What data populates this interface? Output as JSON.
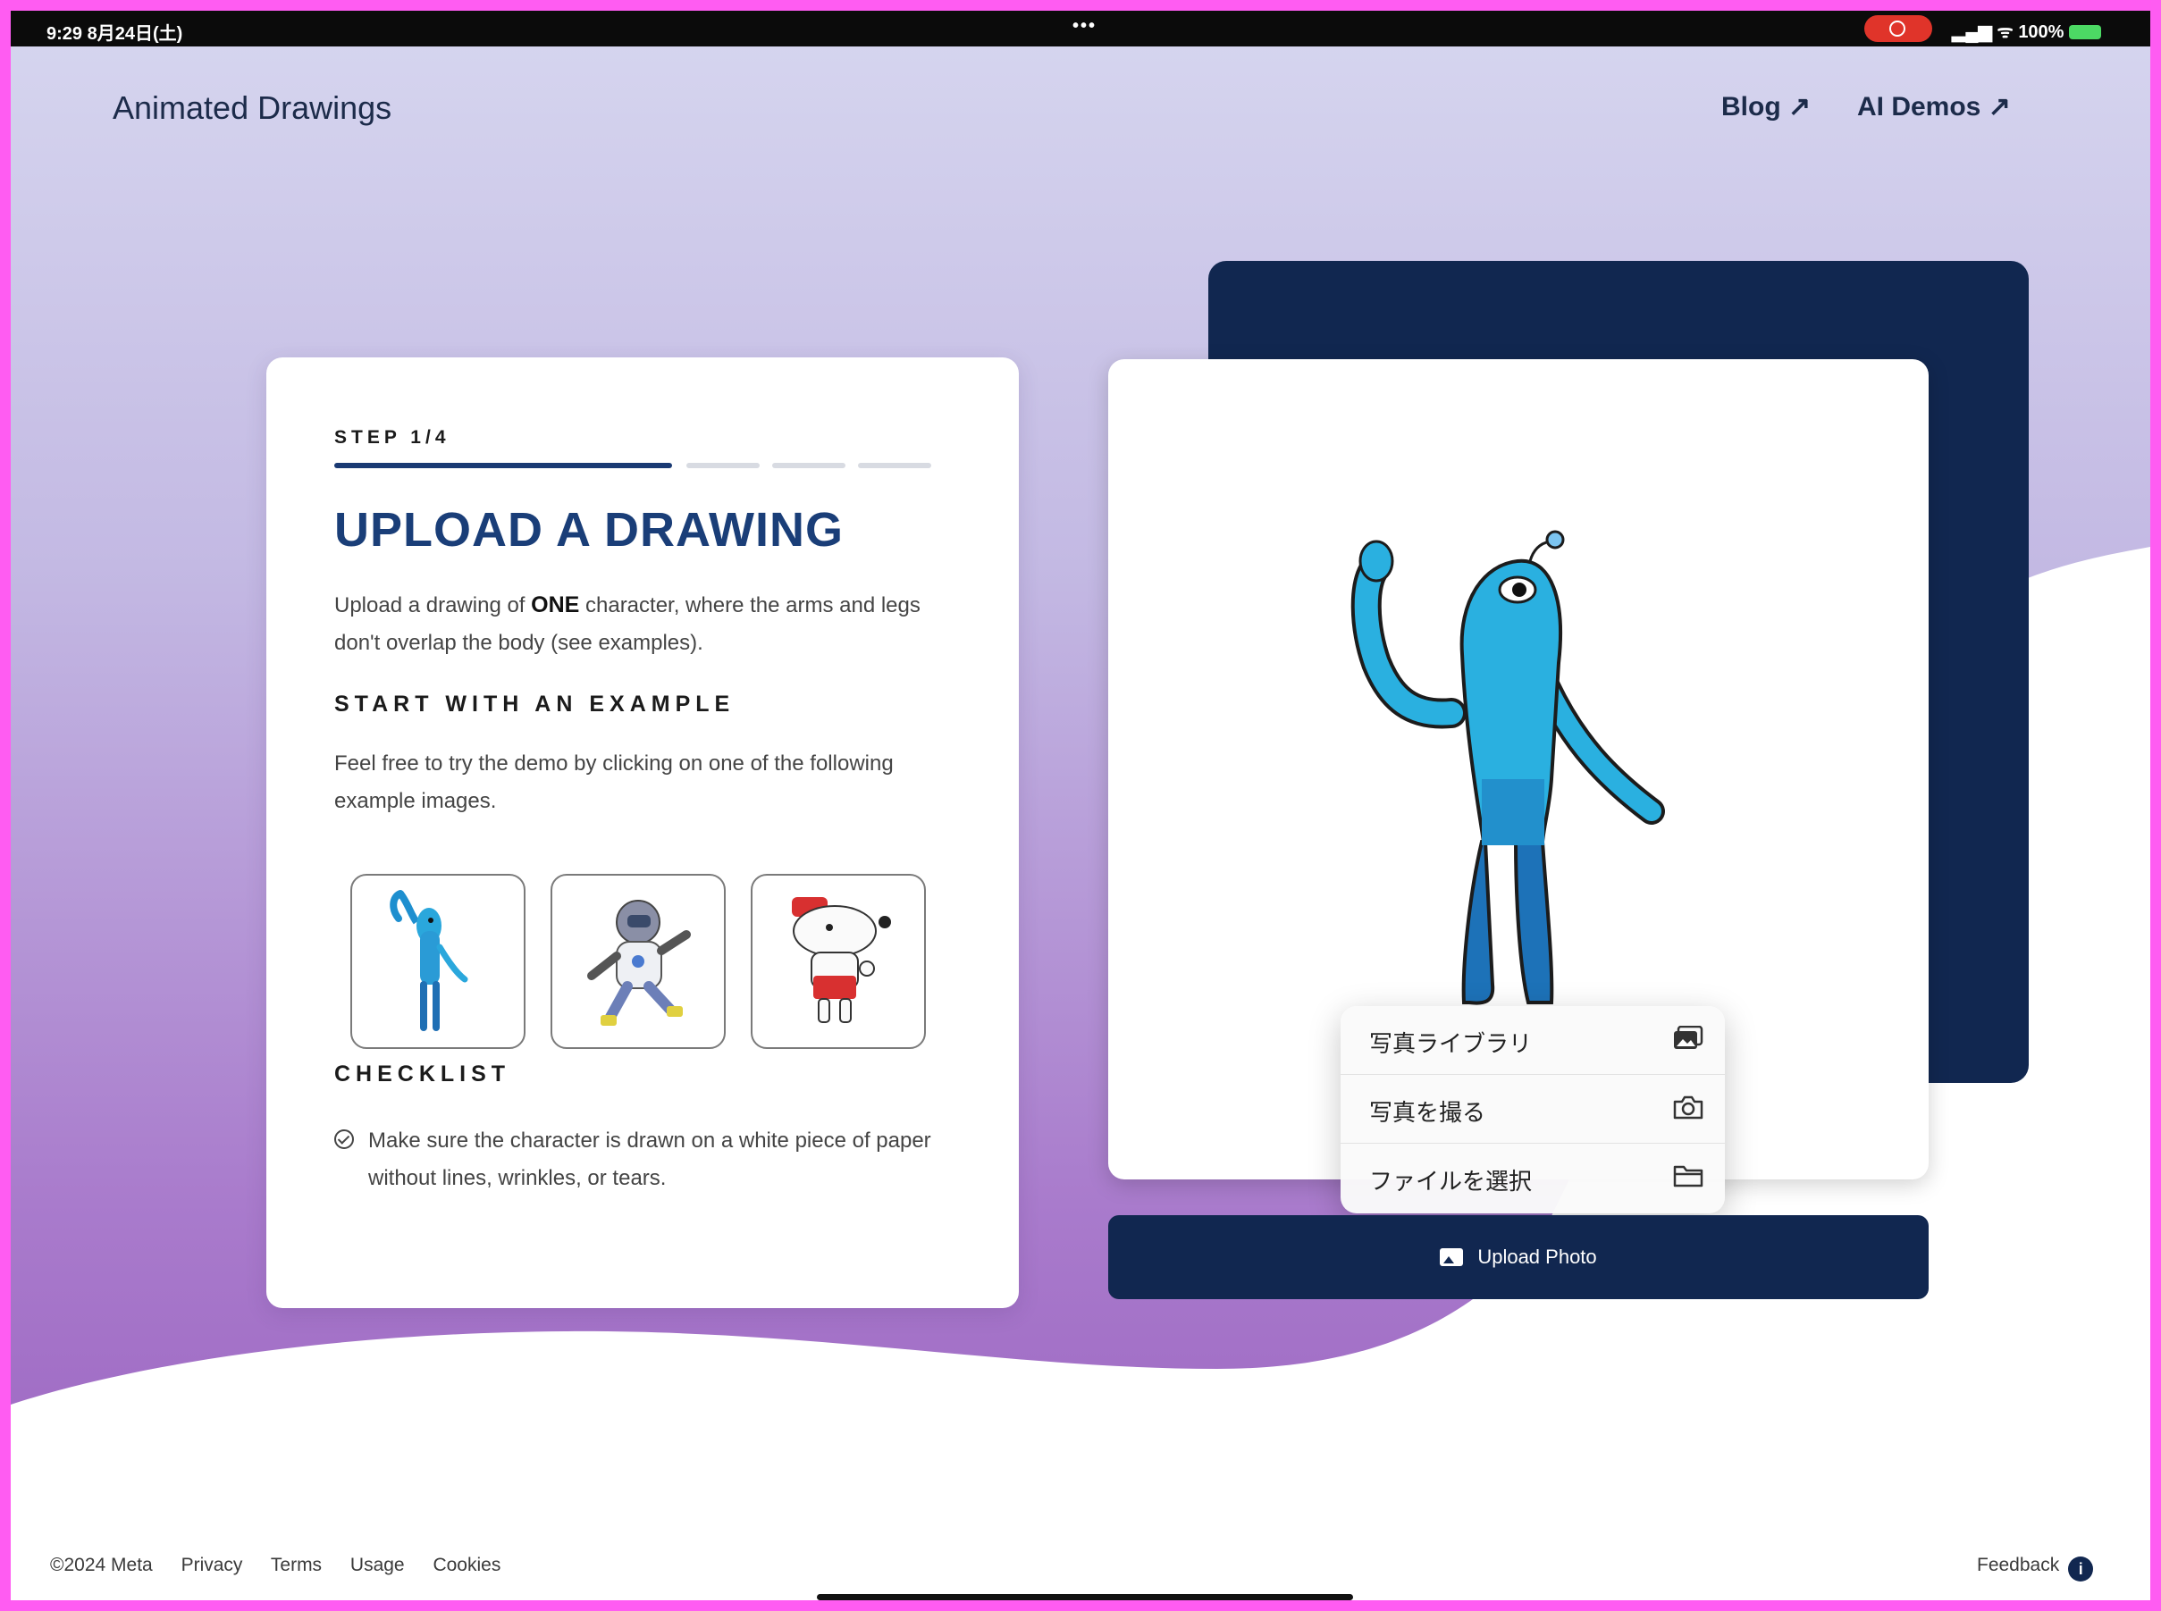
{
  "status_bar": {
    "time_date": "9:29  8月24日(土)",
    "dots": "•••",
    "signal_battery": "100%"
  },
  "header": {
    "title": "Animated Drawings",
    "links": [
      {
        "label": "Blog ↗"
      },
      {
        "label": "AI Demos ↗"
      }
    ]
  },
  "step_card": {
    "step_label": "STEP 1/4",
    "progress": {
      "current": 1,
      "total": 4
    },
    "title": "UPLOAD A DRAWING",
    "desc_before": "Upload a drawing of ",
    "desc_bold": "ONE",
    "desc_after": " character, where the arms and legs don't overlap the body (see examples).",
    "example_heading": "START WITH AN EXAMPLE",
    "example_desc": "Feel free to try the demo by clicking on one of the following example images.",
    "checklist_heading": "CHECKLIST",
    "checklist_items": [
      "Make sure the character is drawn on a white piece of paper without lines, wrinkles, or tears."
    ]
  },
  "picker_menu": {
    "items": [
      {
        "label": "写真ライブラリ",
        "icon": "photo-library-icon"
      },
      {
        "label": "写真を撮る",
        "icon": "camera-icon"
      },
      {
        "label": "ファイルを選択",
        "icon": "folder-icon"
      }
    ]
  },
  "upload_button": {
    "label": "Upload Photo",
    "icon": "image-icon"
  },
  "footer": {
    "copyright": "©2024 Meta",
    "links": [
      "Privacy",
      "Terms",
      "Usage",
      "Cookies"
    ],
    "feedback": "Feedback",
    "feedback_icon": "i"
  },
  "colors": {
    "navy": "#112750",
    "title_blue": "#1a3e78",
    "background_lavender": "#c9c3e8",
    "background_purple": "#a878c8",
    "frame_border": "#ff5cf2"
  }
}
